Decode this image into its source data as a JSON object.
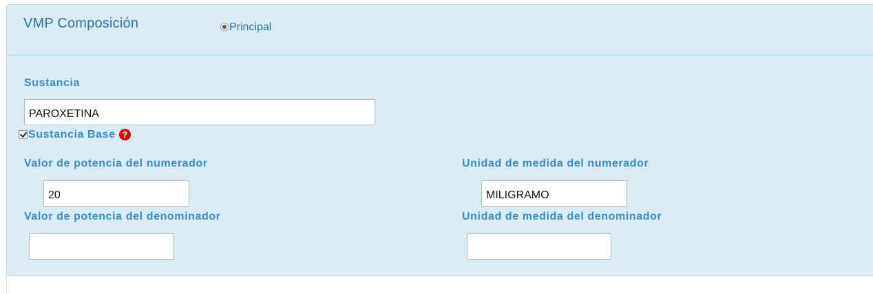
{
  "panel": {
    "title": "VMP Composición",
    "radio_label": "Principal",
    "radio_selected": true
  },
  "fields": {
    "sustancia_label": "Sustancia",
    "sustancia_value": "PAROXETINA",
    "sustancia_base_label": "Sustancia Base",
    "sustancia_base_checked": true,
    "help_icon_glyph": "?",
    "valor_numerador_label": "Valor de potencia del numerador",
    "valor_numerador_value": "20",
    "unidad_numerador_label": "Unidad de medida del numerador",
    "unidad_numerador_value": "MILIGRAMO",
    "valor_denominador_label": "Valor de potencia del denominador",
    "valor_denominador_value": "",
    "unidad_denominador_label": "Unidad de medida del denominador",
    "unidad_denominador_value": ""
  },
  "colors": {
    "panel_bg": "#d9ebf4",
    "label_text": "#3a8cbd",
    "title_text": "#31708f",
    "help_icon_bg": "#e00000"
  },
  "icons": {
    "help": "question-circle-icon",
    "check": "checkmark-icon"
  }
}
